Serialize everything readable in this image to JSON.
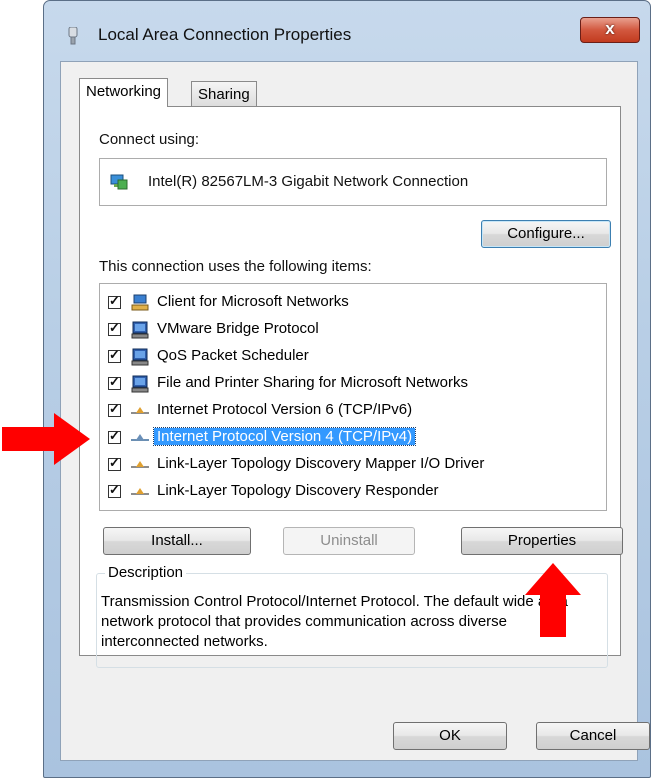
{
  "window": {
    "title": "Local Area Connection Properties",
    "close_label": "x"
  },
  "tabs": [
    {
      "label": "Networking",
      "selected": true
    },
    {
      "label": "Sharing",
      "selected": false
    }
  ],
  "networking": {
    "connect_using_label": "Connect using:",
    "adapter_name": "Intel(R) 82567LM-3 Gigabit Network Connection",
    "configure_label": "Configure...",
    "items_label": "This connection uses the following items:",
    "items": [
      {
        "label": "Client for Microsoft Networks",
        "checked": true,
        "icon": "network-client-icon"
      },
      {
        "label": "VMware Bridge Protocol",
        "checked": true,
        "icon": "network-service-icon"
      },
      {
        "label": "QoS Packet Scheduler",
        "checked": true,
        "icon": "network-service-icon"
      },
      {
        "label": "File and Printer Sharing for Microsoft Networks",
        "checked": true,
        "icon": "network-service-icon"
      },
      {
        "label": "Internet Protocol Version 6 (TCP/IPv6)",
        "checked": true,
        "icon": "protocol-icon"
      },
      {
        "label": "Internet Protocol Version 4 (TCP/IPv4)",
        "checked": true,
        "icon": "protocol-icon",
        "selected": true
      },
      {
        "label": "Link-Layer Topology Discovery Mapper I/O Driver",
        "checked": true,
        "icon": "protocol-icon"
      },
      {
        "label": "Link-Layer Topology Discovery Responder",
        "checked": true,
        "icon": "protocol-icon"
      }
    ],
    "install_label": "Install...",
    "uninstall_label": "Uninstall",
    "properties_label": "Properties",
    "description_legend": "Description",
    "description_text": "Transmission Control Protocol/Internet Protocol. The default wide area network protocol that provides communication across diverse interconnected networks."
  },
  "footer": {
    "ok_label": "OK",
    "cancel_label": "Cancel"
  },
  "colors": {
    "selection": "#3399ff",
    "annotation_arrow": "#ff0000"
  }
}
